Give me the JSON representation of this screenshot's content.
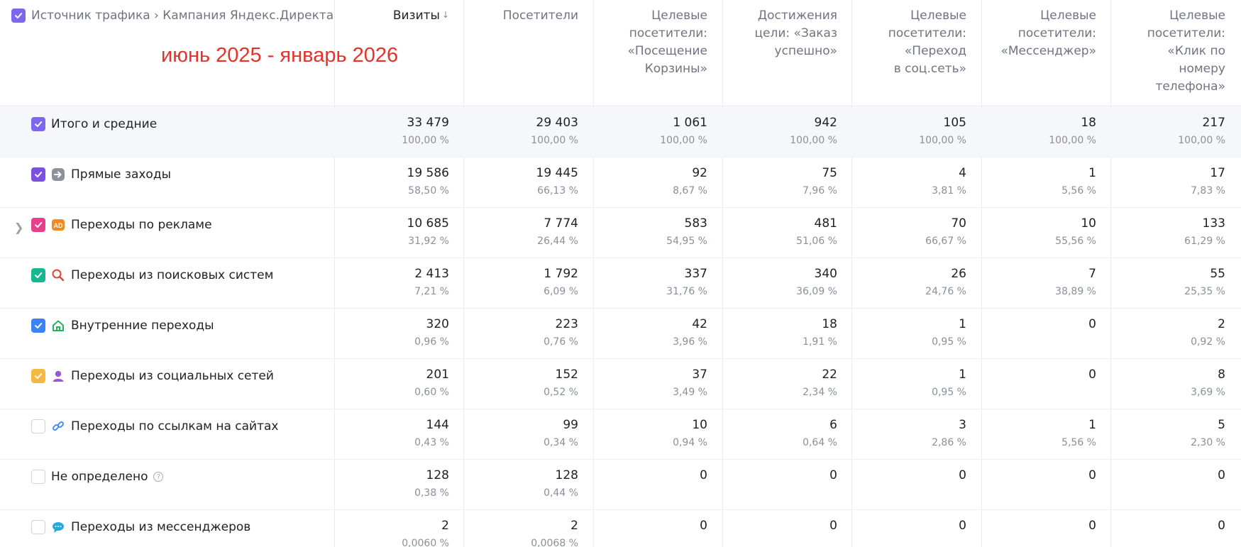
{
  "header": {
    "dimension_label": "Источник трафика › Кампания Яндекс.Директа",
    "period_annotation": "июнь 2025 - январь 2026",
    "columns": [
      {
        "lines": [
          "Визиты"
        ],
        "sorted": true
      },
      {
        "lines": [
          "Посетители"
        ]
      },
      {
        "lines": [
          "Целевые",
          "посетители:",
          "«Посещение",
          "Корзины»"
        ]
      },
      {
        "lines": [
          "Достижения",
          "цели: «Заказ",
          "успешно»"
        ]
      },
      {
        "lines": [
          "Целевые",
          "посетители:",
          "«Переход",
          "в соц.сеть»"
        ]
      },
      {
        "lines": [
          "Целевые",
          "посетители:",
          "«Мессенджер»"
        ]
      },
      {
        "lines": [
          "Целевые",
          "посетители:",
          "«Клик по",
          "номеру",
          "телефона»"
        ]
      }
    ],
    "sort_icon": "arrow-down-icon"
  },
  "rows": [
    {
      "label": "Итого и средние",
      "checkbox": "checked",
      "checkbox_color": "#7b68ee",
      "icon": "none",
      "expandable": false,
      "cells": [
        [
          "33 479",
          "100,00 %"
        ],
        [
          "29 403",
          "100,00 %"
        ],
        [
          "1 061",
          "100,00 %"
        ],
        [
          "942",
          "100,00 %"
        ],
        [
          "105",
          "100,00 %"
        ],
        [
          "18",
          "100,00 %"
        ],
        [
          "217",
          "100,00 %"
        ]
      ]
    },
    {
      "label": "Прямые заходы",
      "checkbox": "checked",
      "checkbox_color": "#7b4fe0",
      "icon": "direct-entry-icon",
      "expandable": false,
      "cells": [
        [
          "19 586",
          "58,50 %"
        ],
        [
          "19 445",
          "66,13 %"
        ],
        [
          "92",
          "8,67 %"
        ],
        [
          "75",
          "7,96 %"
        ],
        [
          "4",
          "3,81 %"
        ],
        [
          "1",
          "5,56 %"
        ],
        [
          "17",
          "7,83 %"
        ]
      ]
    },
    {
      "label": "Переходы по рекламе",
      "checkbox": "checked",
      "checkbox_color": "#e83e8c",
      "icon": "ad-icon",
      "expandable": true,
      "cells": [
        [
          "10 685",
          "31,92 %"
        ],
        [
          "7 774",
          "26,44 %"
        ],
        [
          "583",
          "54,95 %"
        ],
        [
          "481",
          "51,06 %"
        ],
        [
          "70",
          "66,67 %"
        ],
        [
          "10",
          "55,56 %"
        ],
        [
          "133",
          "61,29 %"
        ]
      ]
    },
    {
      "label": "Переходы из поисковых систем",
      "checkbox": "checked",
      "checkbox_color": "#17b890",
      "icon": "search-icon",
      "expandable": false,
      "cells": [
        [
          "2 413",
          "7,21 %"
        ],
        [
          "1 792",
          "6,09 %"
        ],
        [
          "337",
          "31,76 %"
        ],
        [
          "340",
          "36,09 %"
        ],
        [
          "26",
          "24,76 %"
        ],
        [
          "7",
          "38,89 %"
        ],
        [
          "55",
          "25,35 %"
        ]
      ]
    },
    {
      "label": "Внутренние переходы",
      "checkbox": "checked",
      "checkbox_color": "#3b82f6",
      "icon": "home-icon",
      "expandable": false,
      "cells": [
        [
          "320",
          "0,96 %"
        ],
        [
          "223",
          "0,76 %"
        ],
        [
          "42",
          "3,96 %"
        ],
        [
          "18",
          "1,91 %"
        ],
        [
          "1",
          "0,95 %"
        ],
        [
          "0",
          ""
        ],
        [
          "2",
          "0,92 %"
        ]
      ]
    },
    {
      "label": "Переходы из социальных сетей",
      "checkbox": "checked",
      "checkbox_color": "#f5b942",
      "icon": "user-icon",
      "expandable": false,
      "cells": [
        [
          "201",
          "0,60 %"
        ],
        [
          "152",
          "0,52 %"
        ],
        [
          "37",
          "3,49 %"
        ],
        [
          "22",
          "2,34 %"
        ],
        [
          "1",
          "0,95 %"
        ],
        [
          "0",
          ""
        ],
        [
          "8",
          "3,69 %"
        ]
      ]
    },
    {
      "label": "Переходы по ссылкам на сайтах",
      "checkbox": "empty",
      "checkbox_color": "",
      "icon": "link-icon",
      "expandable": false,
      "cells": [
        [
          "144",
          "0,43 %"
        ],
        [
          "99",
          "0,34 %"
        ],
        [
          "10",
          "0,94 %"
        ],
        [
          "6",
          "0,64 %"
        ],
        [
          "3",
          "2,86 %"
        ],
        [
          "1",
          "5,56 %"
        ],
        [
          "5",
          "2,30 %"
        ]
      ]
    },
    {
      "label": "Не определено",
      "checkbox": "empty",
      "checkbox_color": "",
      "icon": "none",
      "help_icon": true,
      "expandable": false,
      "cells": [
        [
          "128",
          "0,38 %"
        ],
        [
          "128",
          "0,44 %"
        ],
        [
          "0",
          ""
        ],
        [
          "0",
          ""
        ],
        [
          "0",
          ""
        ],
        [
          "0",
          ""
        ],
        [
          "0",
          ""
        ]
      ]
    },
    {
      "label": "Переходы из мессенджеров",
      "checkbox": "empty",
      "checkbox_color": "",
      "icon": "chat-icon",
      "expandable": false,
      "cells": [
        [
          "2",
          "0,0060 %"
        ],
        [
          "2",
          "0,0068 %"
        ],
        [
          "0",
          ""
        ],
        [
          "0",
          ""
        ],
        [
          "0",
          ""
        ],
        [
          "0",
          ""
        ],
        [
          "0",
          ""
        ]
      ]
    }
  ],
  "colors": {
    "header_checkbox": "#7b68ee",
    "period_text": "#e5332a",
    "total_row_bg": "#f6f7fa"
  }
}
